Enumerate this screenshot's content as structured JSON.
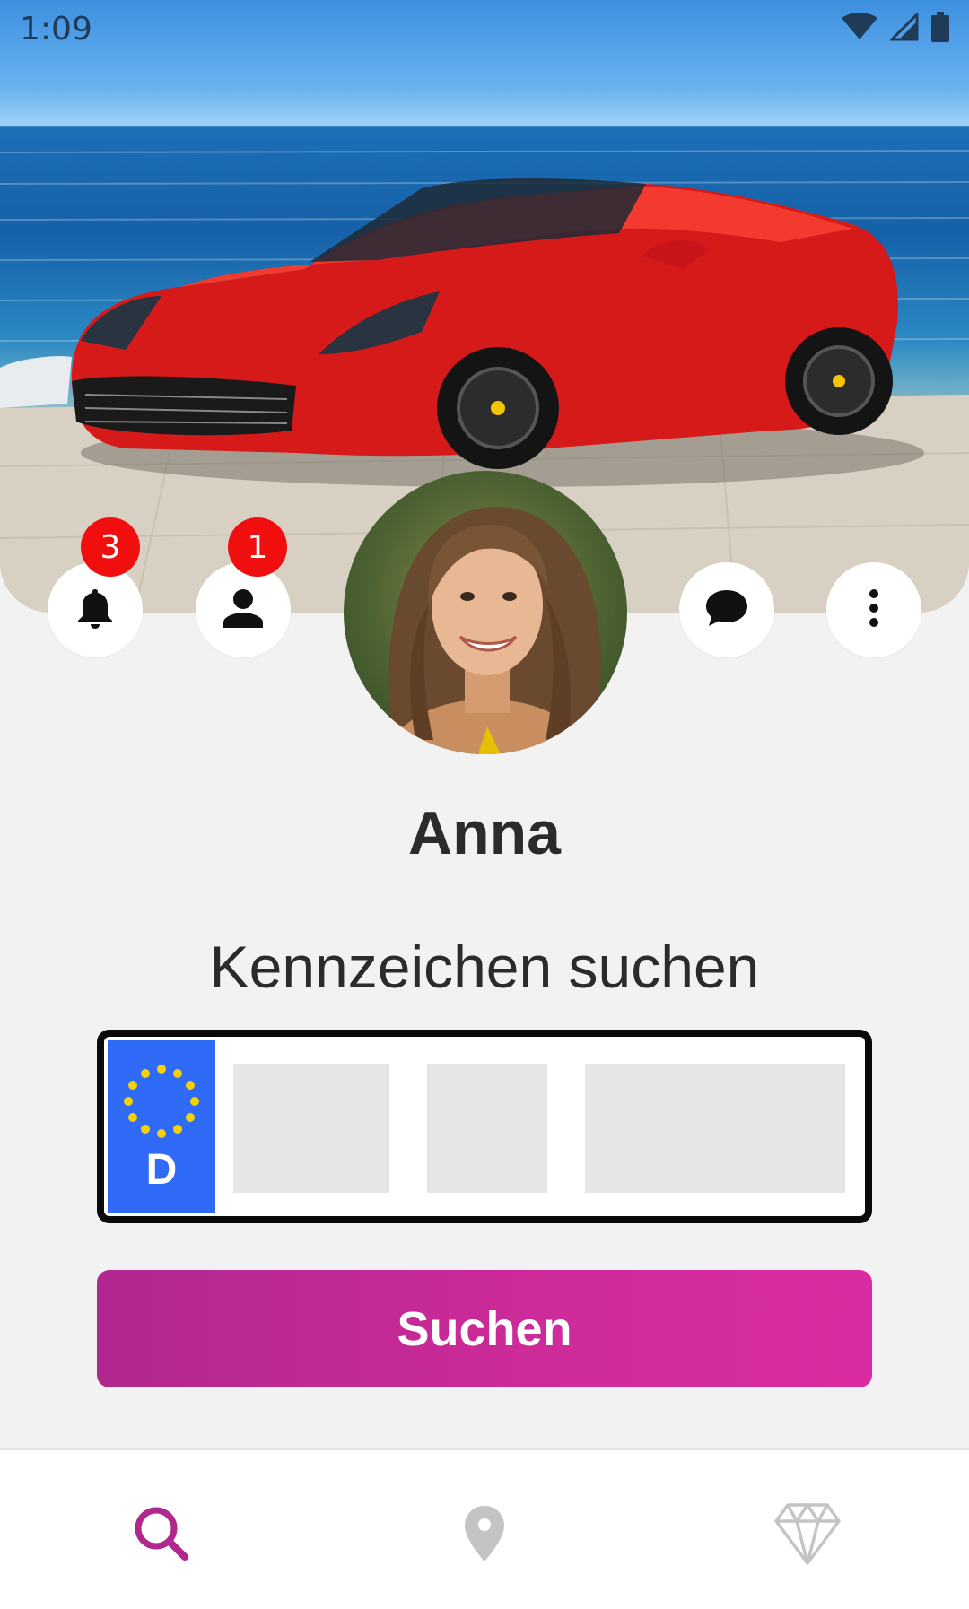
{
  "status_bar": {
    "time": "1:09",
    "icons": [
      "wifi-icon",
      "signal-icon",
      "battery-icon"
    ]
  },
  "header_actions": {
    "notifications": {
      "icon": "bell-icon",
      "badge": "3"
    },
    "friend_requests": {
      "icon": "person-icon",
      "badge": "1"
    },
    "messages": {
      "icon": "chat-bubble-icon"
    },
    "more": {
      "icon": "more-vertical-icon"
    }
  },
  "profile": {
    "name": "Anna"
  },
  "search": {
    "heading": "Kennzeichen suchen",
    "plate": {
      "country_code": "D",
      "field_1": "",
      "field_2": "",
      "field_3": ""
    },
    "button_label": "Suchen"
  },
  "bottom_nav": {
    "items": [
      {
        "icon": "search-icon",
        "active": true
      },
      {
        "icon": "location-pin-icon",
        "active": false
      },
      {
        "icon": "diamond-icon",
        "active": false
      }
    ]
  },
  "colors": {
    "accent": "#b0288e",
    "badge": "#f00e0e",
    "eu_blue": "#2f6bf6",
    "eu_star": "#f5d10a",
    "inactive_icon": "#c4c4c4"
  }
}
